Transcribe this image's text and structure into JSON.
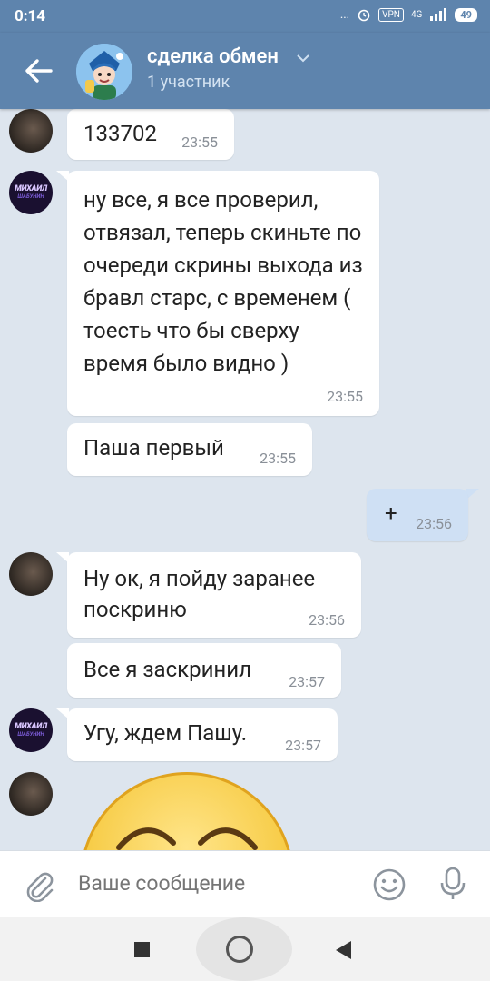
{
  "status_bar": {
    "time": "0:14",
    "dots": "...",
    "vpn": "VPN",
    "network": "4G",
    "battery": "49"
  },
  "header": {
    "title": "сделка обмен",
    "subtitle": "1 участник"
  },
  "avatar_logo": {
    "line1": "МИХАИЛ",
    "line2": "ШАБУНИН"
  },
  "messages": [
    {
      "text": "133702",
      "time": "23:55"
    },
    {
      "text": "ну все, я все проверил, отвязал, теперь скиньте по очереди скрины выхода из бравл старс, с временем ( тоесть что бы сверху время было видно )",
      "time": "23:55"
    },
    {
      "text": "Паша первый",
      "time": "23:55"
    },
    {
      "text": "+",
      "time": "23:56"
    },
    {
      "text": "Ну ок, я пойду заранее поскриню",
      "time": "23:56"
    },
    {
      "text": "Все я заскринил",
      "time": "23:57"
    },
    {
      "text": "Угу, ждем Пашу.",
      "time": "23:57"
    }
  ],
  "composer": {
    "placeholder": "Ваше сообщение"
  },
  "colors": {
    "header": "#5e84ad",
    "background": "#dde5ee",
    "outgoing": "#cfe0f4"
  }
}
